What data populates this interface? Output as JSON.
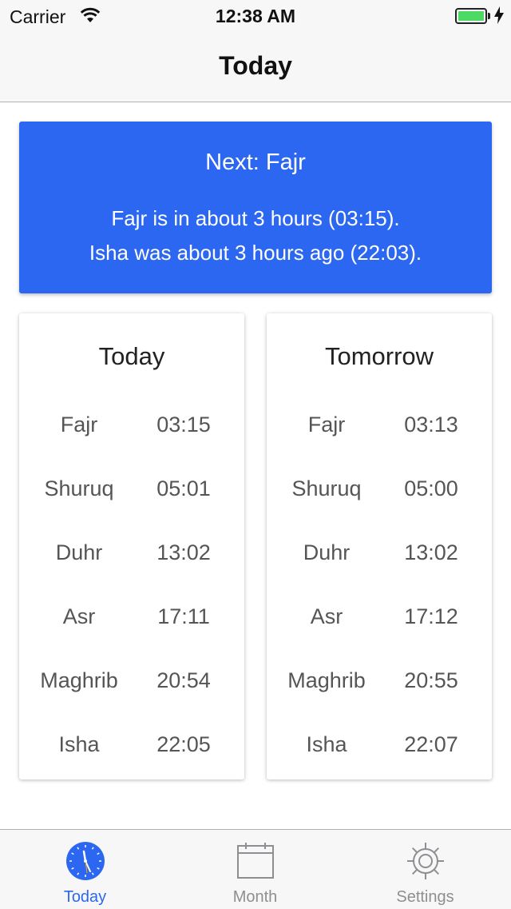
{
  "status_bar": {
    "carrier": "Carrier",
    "time": "12:38 AM",
    "battery_color": "#4cd964"
  },
  "nav": {
    "title": "Today"
  },
  "next_prayer": {
    "title": "Next: Fajr",
    "line1": "Fajr is in about 3 hours (03:15).",
    "line2": "Isha was about 3 hours ago (22:03).",
    "background": "#2c67f2"
  },
  "today": {
    "title": "Today",
    "prayers": [
      {
        "name": "Fajr",
        "time": "03:15"
      },
      {
        "name": "Shuruq",
        "time": "05:01"
      },
      {
        "name": "Duhr",
        "time": "13:02"
      },
      {
        "name": "Asr",
        "time": "17:11"
      },
      {
        "name": "Maghrib",
        "time": "20:54"
      },
      {
        "name": "Isha",
        "time": "22:05"
      }
    ]
  },
  "tomorrow": {
    "title": "Tomorrow",
    "prayers": [
      {
        "name": "Fajr",
        "time": "03:13"
      },
      {
        "name": "Shuruq",
        "time": "05:00"
      },
      {
        "name": "Duhr",
        "time": "13:02"
      },
      {
        "name": "Asr",
        "time": "17:12"
      },
      {
        "name": "Maghrib",
        "time": "20:55"
      },
      {
        "name": "Isha",
        "time": "22:07"
      }
    ]
  },
  "tabs": [
    {
      "label": "Today",
      "icon": "clock-icon",
      "active": true
    },
    {
      "label": "Month",
      "icon": "calendar-icon",
      "active": false
    },
    {
      "label": "Settings",
      "icon": "gear-icon",
      "active": false
    }
  ],
  "accent_color": "#2c67f2"
}
